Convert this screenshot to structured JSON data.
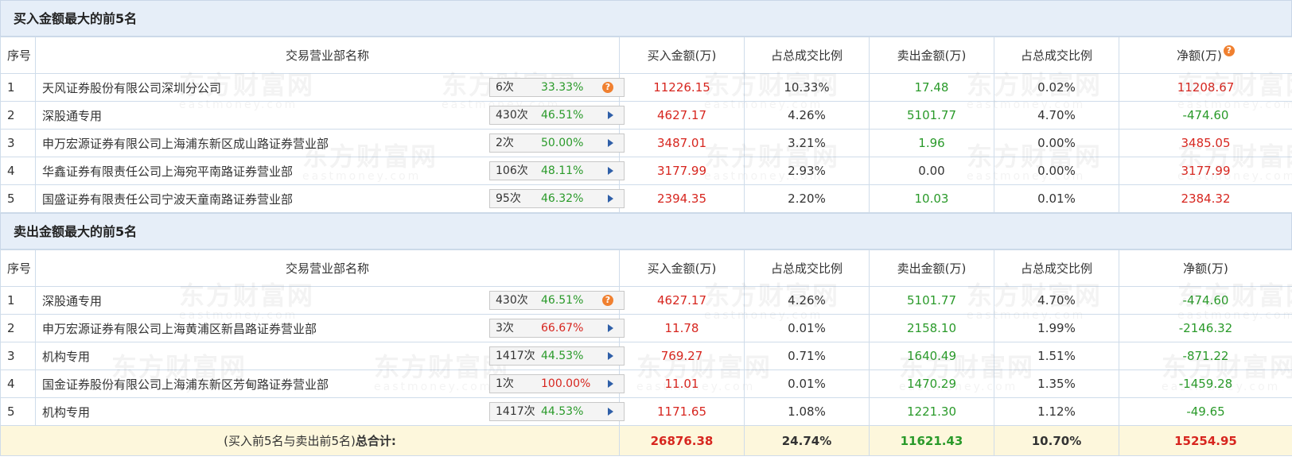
{
  "watermark": {
    "text": "东方财富网",
    "sub": "eastmoney.com"
  },
  "buy_section": {
    "title": "买入金额最大的前5名",
    "headers": [
      "序号",
      "交易营业部名称",
      "买入金额(万)",
      "占总成交比例",
      "卖出金额(万)",
      "占总成交比例",
      "净额(万)"
    ],
    "rows": [
      {
        "no": "1",
        "name": "天风证券股份有限公司深圳分公司",
        "count": "6次",
        "rate": "33.33%",
        "buy": "11226.15",
        "buy_pct": "10.33%",
        "sell": "17.48",
        "sell_pct": "0.02%",
        "net": "11208.67"
      },
      {
        "no": "2",
        "name": "深股通专用",
        "count": "430次",
        "rate": "46.51%",
        "buy": "4627.17",
        "buy_pct": "4.26%",
        "sell": "5101.77",
        "sell_pct": "4.70%",
        "net": "-474.60"
      },
      {
        "no": "3",
        "name": "申万宏源证券有限公司上海浦东新区成山路证券营业部",
        "count": "2次",
        "rate": "50.00%",
        "buy": "3487.01",
        "buy_pct": "3.21%",
        "sell": "1.96",
        "sell_pct": "0.00%",
        "net": "3485.05"
      },
      {
        "no": "4",
        "name": "华鑫证券有限责任公司上海宛平南路证券营业部",
        "count": "106次",
        "rate": "48.11%",
        "buy": "3177.99",
        "buy_pct": "2.93%",
        "sell": "0.00",
        "sell_pct": "0.00%",
        "net": "3177.99"
      },
      {
        "no": "5",
        "name": "国盛证券有限责任公司宁波天童南路证券营业部",
        "count": "95次",
        "rate": "46.32%",
        "buy": "2394.35",
        "buy_pct": "2.20%",
        "sell": "10.03",
        "sell_pct": "0.01%",
        "net": "2384.32"
      }
    ]
  },
  "sell_section": {
    "title": "卖出金额最大的前5名",
    "headers": [
      "序号",
      "交易营业部名称",
      "买入金额(万)",
      "占总成交比例",
      "卖出金额(万)",
      "占总成交比例",
      "净额(万)"
    ],
    "rows": [
      {
        "no": "1",
        "name": "深股通专用",
        "count": "430次",
        "rate": "46.51%",
        "buy": "4627.17",
        "buy_pct": "4.26%",
        "sell": "5101.77",
        "sell_pct": "4.70%",
        "net": "-474.60"
      },
      {
        "no": "2",
        "name": "申万宏源证券有限公司上海黄浦区新昌路证券营业部",
        "count": "3次",
        "rate": "66.67%",
        "buy": "11.78",
        "buy_pct": "0.01%",
        "sell": "2158.10",
        "sell_pct": "1.99%",
        "net": "-2146.32"
      },
      {
        "no": "3",
        "name": "机构专用",
        "count": "1417次",
        "rate": "44.53%",
        "buy": "769.27",
        "buy_pct": "0.71%",
        "sell": "1640.49",
        "sell_pct": "1.51%",
        "net": "-871.22"
      },
      {
        "no": "4",
        "name": "国金证券股份有限公司上海浦东新区芳甸路证券营业部",
        "count": "1次",
        "rate": "100.00%",
        "buy": "11.01",
        "buy_pct": "0.01%",
        "sell": "1470.29",
        "sell_pct": "1.35%",
        "net": "-1459.28"
      },
      {
        "no": "5",
        "name": "机构专用",
        "count": "1417次",
        "rate": "44.53%",
        "buy": "1171.65",
        "buy_pct": "1.08%",
        "sell": "1221.30",
        "sell_pct": "1.12%",
        "net": "-49.65"
      }
    ]
  },
  "total": {
    "label_prefix": "(买入前5名与卖出前5名)",
    "label_bold": "总合计:",
    "buy": "26876.38",
    "buy_pct": "24.74%",
    "sell": "11621.43",
    "sell_pct": "10.70%",
    "net": "15254.95"
  },
  "icons": {
    "question": "?",
    "arrow": "play-right-icon"
  },
  "colors": {
    "red": "#d7261f",
    "green": "#2a9a2a",
    "header_bg": "#e6eef8",
    "total_bg": "#fdf7dc",
    "hint": "#f08030"
  }
}
